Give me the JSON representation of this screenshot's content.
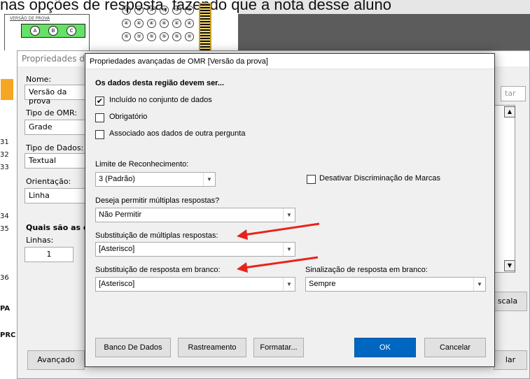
{
  "background": {
    "caption": "nas opções de resposta, fazendo que a nota desse aluno",
    "sheet_label": "VERSÃO DE PROVA",
    "version_bubbles": [
      "A",
      "B",
      "C"
    ],
    "grid_rows": [
      [
        "③",
        "③",
        "③",
        "③",
        "③",
        "③"
      ],
      [
        "④",
        "④",
        "④",
        "④",
        "④",
        "④"
      ],
      [
        "⑤",
        "⑤",
        "⑤",
        "⑤",
        "⑤",
        "⑤"
      ]
    ],
    "row_numbers": [
      "31",
      "32",
      "33",
      "34",
      "35",
      "36"
    ],
    "side_labels": [
      "PA",
      "PRC"
    ]
  },
  "props_dialog": {
    "title": "Propriedades da P",
    "name_label": "Nome:",
    "name_value": "Versão da prova",
    "omr_type_label": "Tipo de OMR:",
    "omr_type_value": "Grade",
    "data_type_label": "Tipo de Dados:",
    "data_type_value": "Textual",
    "orientation_label": "Orientação:",
    "orientation_value": "Linha",
    "dims_label": "Quais são as dim",
    "rows_label": "Linhas:",
    "rows_value": "1",
    "advanced_button": "Avançado",
    "right_button_top": "tar",
    "right_button_mid": "scala",
    "right_button_bottom": "lar"
  },
  "dialog": {
    "title": "Propriedades avançadas de OMR [Versão da prova]",
    "section_heading": "Os dados desta região devem ser...",
    "checkboxes": [
      {
        "label": "Incluído no conjunto de dados",
        "checked": true
      },
      {
        "label": "Obrigatório",
        "checked": false
      },
      {
        "label": "Associado aos dados de outra pergunta",
        "checked": false
      }
    ],
    "recognition_limit_label": "Limite de Reconhecimento:",
    "recognition_limit_value": "3 (Padrão)",
    "disable_discrimination_label": "Desativar Discriminação de Marcas",
    "multiple_answers_label": "Deseja permitir múltiplas respostas?",
    "multiple_answers_value": "Não Permitir",
    "multiple_substitution_label": "Substituição de múltiplas respostas:",
    "multiple_substitution_value": "[Asterisco]",
    "blank_substitution_label": "Substituição de resposta em branco:",
    "blank_substitution_value": "[Asterisco]",
    "blank_signal_label": "Sinalização de resposta em branco:",
    "blank_signal_value": "Sempre",
    "buttons": {
      "database": "Banco De Dados",
      "tracking": "Rastreamento",
      "format": "Formatar...",
      "ok": "OK",
      "cancel": "Cancelar"
    }
  },
  "colors": {
    "accent": "#0067c0",
    "annotation_arrow": "#e8231c",
    "highlight_green": "#66e066"
  }
}
